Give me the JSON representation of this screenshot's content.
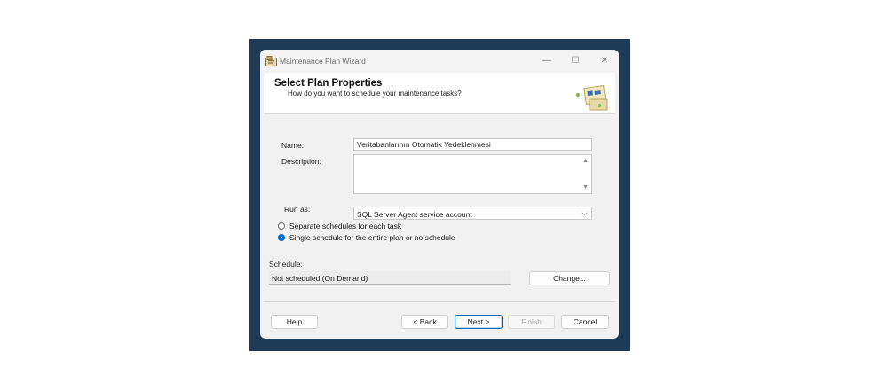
{
  "window": {
    "title": "Maintenance Plan Wizard",
    "controls": {
      "minimize": "—",
      "maximize": "☐",
      "close": "✕"
    }
  },
  "header": {
    "title": "Select Plan Properties",
    "subtitle": "How do you want to schedule your maintenance tasks?"
  },
  "form": {
    "name_label": "Name:",
    "name_value": "Veritabanlarının Otomatik Yedeklenmesi",
    "description_label": "Description:",
    "description_value": "",
    "run_as_label": "Run as:",
    "run_as_value": "SQL Server Agent service account",
    "radio_separate": "Separate schedules for each task",
    "radio_single": "Single schedule for the entire plan or no schedule",
    "selected_radio": "single"
  },
  "schedule": {
    "label": "Schedule:",
    "value": "Not scheduled (On Demand)",
    "change_button": "Change..."
  },
  "footer": {
    "help": "Help",
    "back": "< Back",
    "next": "Next >",
    "finish": "Finish",
    "cancel": "Cancel"
  },
  "colors": {
    "backdrop": "#1e3a55",
    "accent": "#0067c0",
    "window_bg": "#f1f1f1"
  },
  "icons": [
    "app-icon",
    "minimize-icon",
    "maximize-icon",
    "close-icon",
    "wizard-illustration",
    "scroll-up-icon",
    "scroll-down-icon",
    "chevron-down-icon"
  ]
}
